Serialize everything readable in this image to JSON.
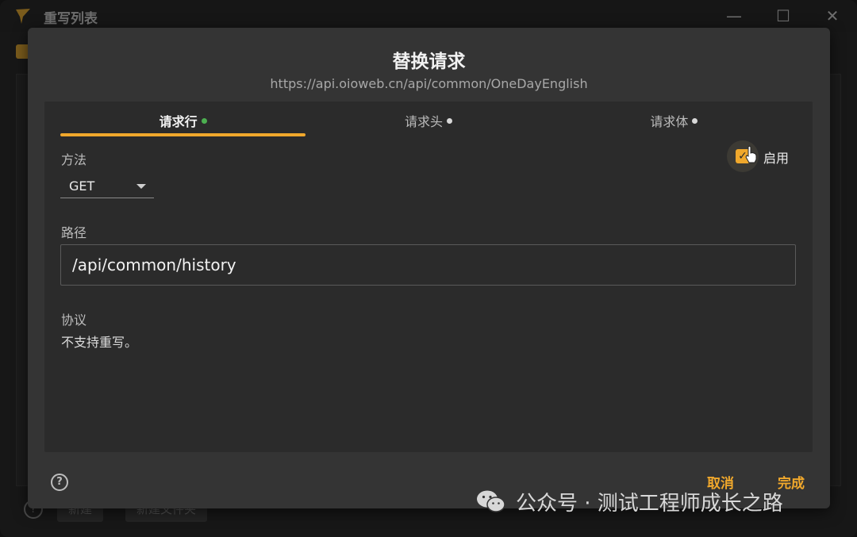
{
  "window": {
    "title": "重写列表",
    "minimize_glyph": "—",
    "maximize_glyph": "☐",
    "close_glyph": "✕"
  },
  "background_footer": {
    "help_glyph": "?",
    "new_label": "新建",
    "new_folder_label": "新建文件夹"
  },
  "dialog": {
    "title": "替换请求",
    "url": "https://api.oioweb.cn/api/common/OneDayEnglish",
    "tabs": [
      {
        "label": "请求行"
      },
      {
        "label": "请求头"
      },
      {
        "label": "请求体"
      }
    ],
    "method": {
      "label": "方法",
      "value": "GET"
    },
    "enable": {
      "label": "启用",
      "checked": true
    },
    "path": {
      "label": "路径",
      "value": "/api/common/history"
    },
    "protocol": {
      "label": "协议",
      "note": "不支持重写。"
    },
    "help_glyph": "?",
    "cancel_label": "取消",
    "done_label": "完成"
  },
  "watermark": {
    "text": "公众号 · 测试工程师成长之路"
  },
  "colors": {
    "accent": "#f0a82c",
    "active_dot": "#4caf50",
    "dialog_bg": "#343434",
    "panel_bg": "#2b2b2b"
  }
}
